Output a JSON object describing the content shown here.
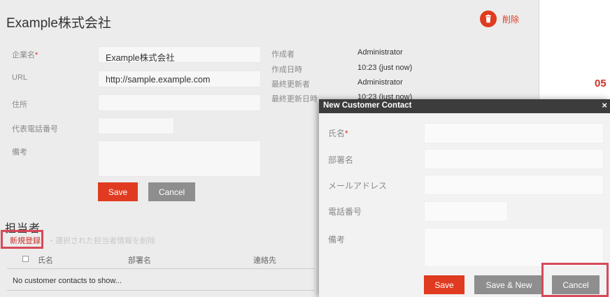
{
  "company": {
    "title": "Example株式会社",
    "delete_label": "削除",
    "fields": {
      "name_label": "企業名",
      "required_mark": "*",
      "name_value": "Example株式会社",
      "url_label": "URL",
      "url_value": "http://sample.example.com",
      "address_label": "住所",
      "address_value": "",
      "phone_label": "代表電話番号",
      "phone_value": "",
      "notes_label": "備考",
      "notes_value": ""
    },
    "meta": {
      "created_by_label": "作成者",
      "created_by_value": "Administrator",
      "created_at_label": "作成日時",
      "created_at_value": "10:23 (just now)",
      "updated_by_label": "最終更新者",
      "updated_by_value": "Administrator",
      "updated_at_label": "最終更新日時",
      "updated_at_value": "10:23 (just now)"
    },
    "save_label": "Save",
    "cancel_label": "Cancel"
  },
  "contacts": {
    "section_title": "担当者",
    "new_label": "新規登録",
    "delete_selected_label": "・選択された担当者情報を削除",
    "columns": [
      "氏名",
      "部署名",
      "連絡先"
    ],
    "empty_text": "No customer contacts to show..."
  },
  "background_number": "05",
  "dialog": {
    "title": "New Customer Contact",
    "close_icon": "×",
    "fields": [
      {
        "label": "氏名",
        "required": "*",
        "value": ""
      },
      {
        "label": "部署名",
        "required": "",
        "value": ""
      },
      {
        "label": "メールアドレス",
        "required": "",
        "value": ""
      },
      {
        "label": "電話番号",
        "required": "",
        "value": ""
      },
      {
        "label": "備考",
        "required": "",
        "value": ""
      }
    ],
    "save_label": "Save",
    "save_new_label": "Save & New",
    "cancel_label": "Cancel"
  },
  "colors": {
    "accent_red": "#e03b20",
    "highlight_box": "#d64a5a",
    "dialog_header": "#3c3c3c",
    "button_gray": "#8e8e8e"
  }
}
